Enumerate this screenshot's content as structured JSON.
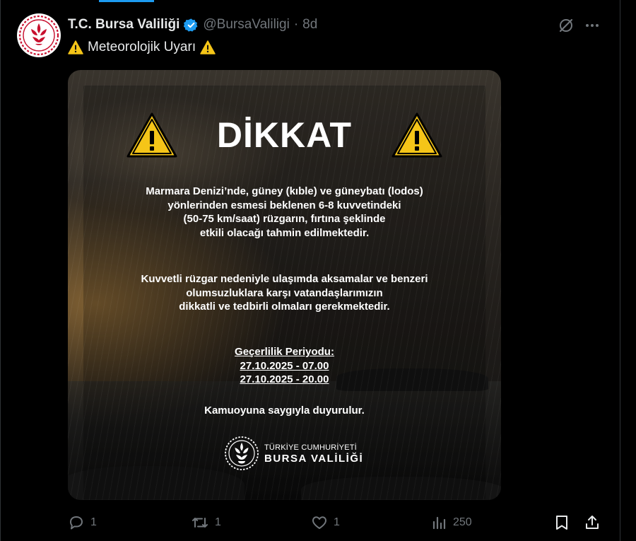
{
  "tweet": {
    "author_name": "T.C. Bursa Valiliği",
    "handle": "@BursaValiligi",
    "separator": "·",
    "time": "8d",
    "text": "Meteorolojik Uyarı"
  },
  "poster": {
    "title": "DİKKAT",
    "paragraph1": [
      "Marmara Denizi’nde, güney (kıble) ve güneybatı (lodos)",
      "yönlerinden esmesi beklenen 6-8 kuvvetindeki",
      "(50-75 km/saat) rüzgarın, fırtına şeklinde",
      "etkili olacağı tahmin edilmektedir."
    ],
    "paragraph2": [
      "Kuvvetli rüzgar nedeniyle ulaşımda aksamalar ve benzeri",
      "olumsuzluklara karşı vatandaşlarımızın",
      "dikkatli ve tedbirli olmaları gerekmektedir."
    ],
    "validity_label": "Geçerlilik Periyodu:",
    "validity_start": "27.10.2025 - 07.00",
    "validity_end": "27.10.2025 - 20.00",
    "closing": "Kamuoyuna saygıyla duyurulur.",
    "logo_line1": "TÜRKİYE CUMHURİYETİ",
    "logo_line2": "BURSA VALİLİĞİ"
  },
  "actions": {
    "replies": "1",
    "reposts": "1",
    "likes": "1",
    "views": "250"
  },
  "colors": {
    "background": "#000000",
    "text": "#e7e9ea",
    "muted": "#71767b",
    "verified": "#1d9bf0",
    "warning": "#f5c518",
    "avatar_red": "#c8102e"
  },
  "icons": [
    "verified-icon",
    "warning-icon",
    "grok-icon",
    "more-icon",
    "reply-icon",
    "repost-icon",
    "like-icon",
    "views-icon",
    "bookmark-icon",
    "share-icon"
  ]
}
